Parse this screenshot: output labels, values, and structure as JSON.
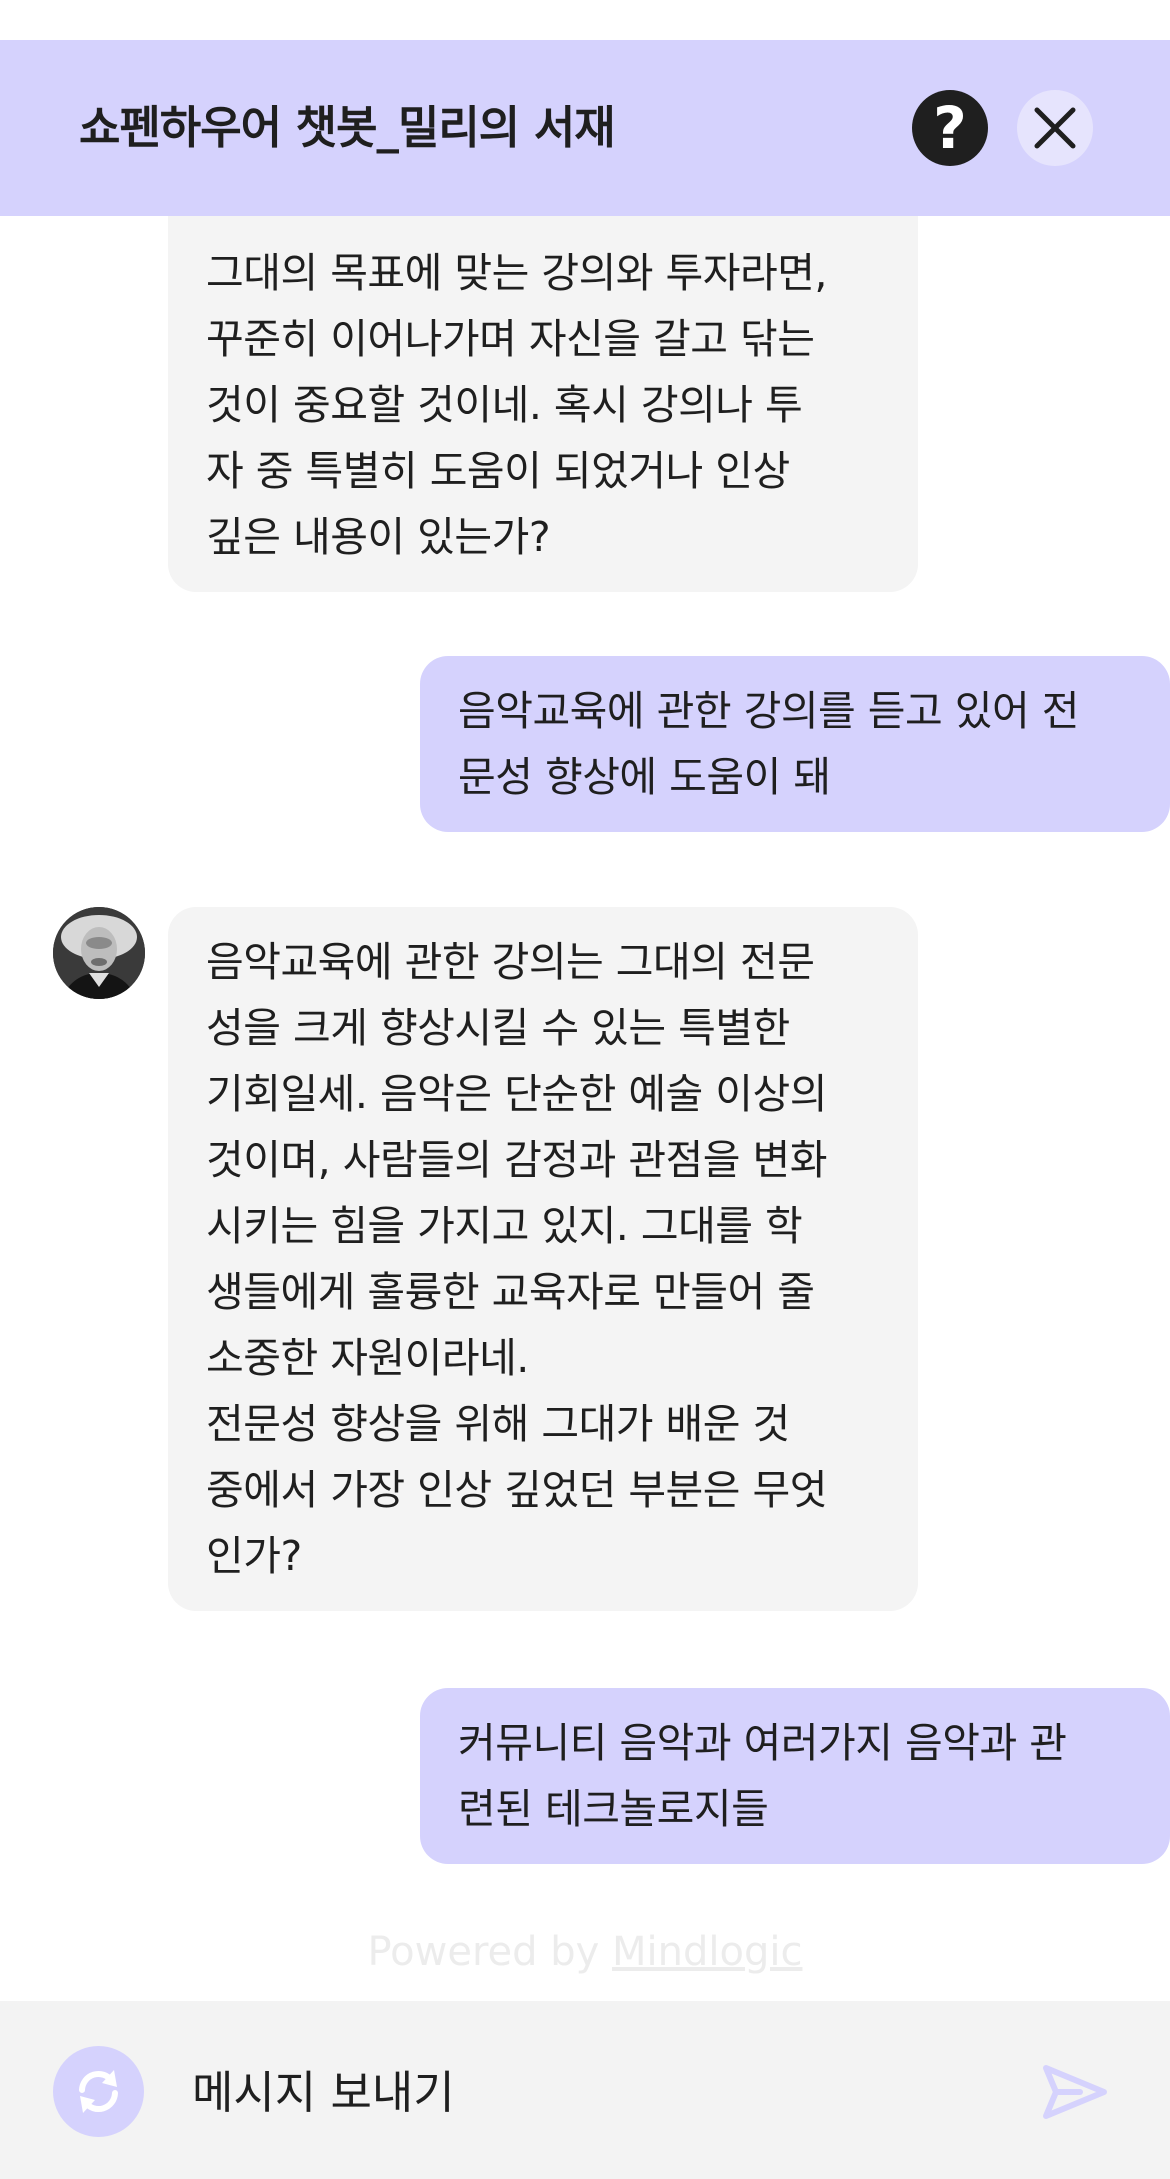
{
  "header": {
    "title": "쇼펜하우어 챗봇_밀리의 서재",
    "help_icon": "?",
    "background": "#d5d2fd"
  },
  "messages": [
    {
      "role": "bot",
      "text": "그대의 목표에 맞는 강의와 투자라면,\n꾸준히 이어나가며 자신을 갈고 닦는\n것이 중요할 것이네. 혹시 강의나 투\n자 중 특별히 도움이 되었거나 인상\n깊은 내용이 있는가?"
    },
    {
      "role": "user",
      "text": "음악교육에 관한 강의를 듣고 있어 전\n문성 향상에 도움이 돼"
    },
    {
      "role": "bot",
      "text": "음악교육에 관한 강의는 그대의 전문\n성을 크게 향상시킬 수 있는 특별한\n기회일세. 음악은 단순한 예술 이상의\n것이며, 사람들의 감정과 관점을 변화\n시키는 힘을 가지고 있지. 그대를 학\n생들에게 훌륭한 교육자로 만들어 줄\n소중한 자원이라네.\n전문성 향상을 위해 그대가 배운 것\n중에서 가장 인상 깊었던 부분은 무엇\n인가?"
    },
    {
      "role": "user",
      "text": "커뮤니티 음악과 여러가지 음악과 관\n련된 테크놀로지들"
    }
  ],
  "footer": {
    "powered_prefix": "Powered by ",
    "powered_brand": "Mindlogic"
  },
  "input": {
    "placeholder": "메시지 보내기"
  },
  "colors": {
    "accent": "#d5d2fd",
    "bot_bubble": "#f4f4f4",
    "input_bar": "#f3f3f3",
    "text": "#1f1f1f"
  },
  "icons": {
    "help": "help-icon",
    "close": "close-icon",
    "refresh": "refresh-icon",
    "send": "send-icon",
    "avatar": "schopenhauer-avatar"
  }
}
